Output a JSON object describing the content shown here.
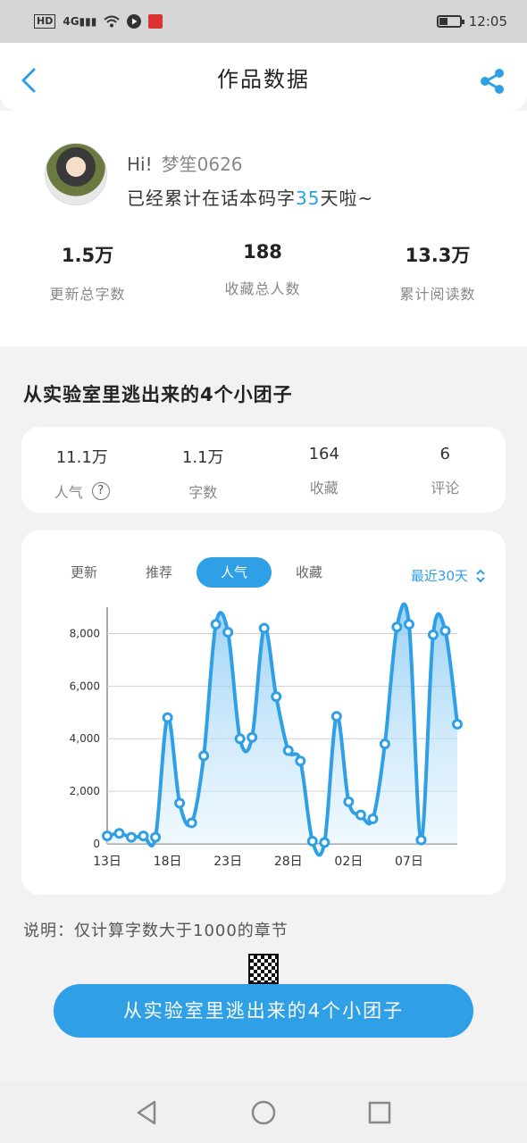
{
  "status_bar": {
    "left_icons": [
      "hd-icon",
      "signal-4g-icon",
      "wifi-icon",
      "play-icon",
      "app-badge-icon"
    ],
    "hd": "HD",
    "network": "4G",
    "time": "12:05",
    "battery_level": 0.4
  },
  "header": {
    "title": "作品数据"
  },
  "profile": {
    "greeting": "Hi!",
    "username": "梦笙0626",
    "days_prefix": "已经累计在话本码字",
    "days_value": "35",
    "days_suffix": "天啦~",
    "stats": [
      {
        "value": "1.5万",
        "label": "更新总字数"
      },
      {
        "value": "188",
        "label": "收藏总人数"
      },
      {
        "value": "13.3万",
        "label": "累计阅读数"
      }
    ]
  },
  "book": {
    "title": "从实验室里逃出来的4个小团子",
    "stats": [
      {
        "value": "11.1万",
        "label": "人气"
      },
      {
        "value": "1.1万",
        "label": "字数"
      },
      {
        "value": "164",
        "label": "收藏"
      },
      {
        "value": "6",
        "label": "评论"
      }
    ]
  },
  "chart_tabs": [
    {
      "label": "更新",
      "active": false
    },
    {
      "label": "推荐",
      "active": false
    },
    {
      "label": "人气",
      "active": true
    },
    {
      "label": "收藏",
      "active": false
    }
  ],
  "range_label": "最近30天",
  "colors": {
    "accent": "#2f9fe6",
    "line": "#2f9fe6"
  },
  "chart_data": {
    "type": "area",
    "title": "",
    "xlabel": "",
    "ylabel": "",
    "ylim": [
      0,
      9000
    ],
    "yticks": [
      0,
      2000,
      4000,
      6000,
      8000
    ],
    "ytick_labels": [
      "0",
      "2,000",
      "4,000",
      "6,000",
      "8,000"
    ],
    "xtick_labels": [
      {
        "index": 0,
        "label": "13日"
      },
      {
        "index": 5,
        "label": "18日"
      },
      {
        "index": 10,
        "label": "23日"
      },
      {
        "index": 15,
        "label": "28日"
      },
      {
        "index": 20,
        "label": "02日"
      },
      {
        "index": 25,
        "label": "07日"
      }
    ],
    "grid": true,
    "values": [
      300,
      400,
      250,
      300,
      250,
      4800,
      1550,
      800,
      3350,
      8350,
      8050,
      4000,
      4050,
      8200,
      5600,
      3550,
      3150,
      100,
      50,
      4850,
      1600,
      1100,
      950,
      3800,
      8250,
      8350,
      150,
      7950,
      8100,
      4550
    ]
  },
  "note": "说明：仅计算字数大于1000的章节",
  "cta": {
    "label": "从实验室里逃出来的4个小团子"
  }
}
